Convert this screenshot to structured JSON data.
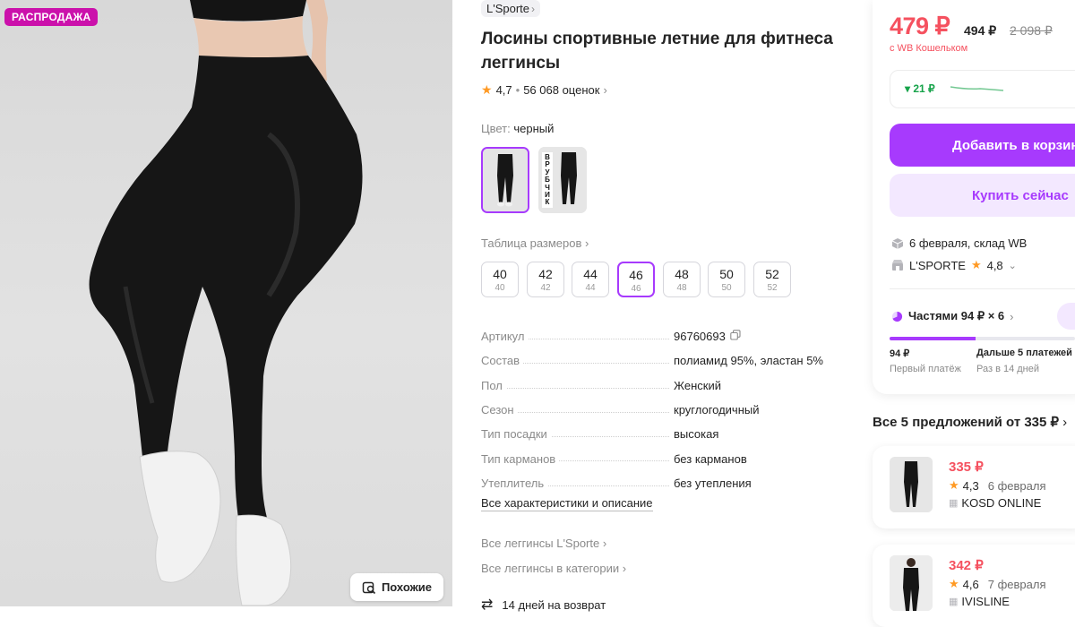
{
  "gallery": {
    "badge": "РАСПРОДАЖА",
    "similar_label": "Похожие"
  },
  "product": {
    "brand": "L'Sporte",
    "title": "Лосины спортивные летние для фитнеса леггинсы",
    "rating": "4,7",
    "reviews": "56 068 оценок",
    "color_label": "Цвет:",
    "color_value": "черный",
    "swatch2_text": "ВРУБЧИК",
    "sizes_link": "Таблица размеров",
    "sizes": [
      {
        "main": "40",
        "sub": "40"
      },
      {
        "main": "42",
        "sub": "42"
      },
      {
        "main": "44",
        "sub": "44"
      },
      {
        "main": "46",
        "sub": "46"
      },
      {
        "main": "48",
        "sub": "48"
      },
      {
        "main": "50",
        "sub": "50"
      },
      {
        "main": "52",
        "sub": "52"
      }
    ],
    "selected_size": "46",
    "specs": [
      {
        "k": "Артикул",
        "v": "96760693"
      },
      {
        "k": "Состав",
        "v": "полиамид 95%, эластан 5%"
      },
      {
        "k": "Пол",
        "v": "Женский"
      },
      {
        "k": "Сезон",
        "v": "круглогодичный"
      },
      {
        "k": "Тип посадки",
        "v": "высокая"
      },
      {
        "k": "Тип карманов",
        "v": "без карманов"
      },
      {
        "k": "Утеплитель",
        "v": "без утепления"
      }
    ],
    "all_specs": "Все характеристики и описание",
    "link_brand": "Все леггинсы L'Sporte",
    "link_category": "Все леггинсы в категории",
    "return_text": "14 дней на возврат"
  },
  "buy": {
    "price": "479 ₽",
    "price_old1": "494 ₽",
    "price_old2": "2 098 ₽",
    "wallet": "с WB Кошельком",
    "price_drop": "▾ 21 ₽",
    "add_to_cart": "Добавить в корзину",
    "buy_now": "Купить сейчас",
    "delivery": "6 февраля, склад WB",
    "seller": "L'SPORTE",
    "seller_rating": "4,8",
    "installments": "Частями 94 ₽ × 6",
    "installment_progress": 0.466,
    "pay1": "94 ₽",
    "pay1_sub": "Первый платёж",
    "pay2": "Дальше 5 платежей",
    "pay2_sub": "Раз в 14 дней"
  },
  "offers": {
    "title": "Все 5 предложений от 335 ₽",
    "items": [
      {
        "price": "335 ₽",
        "rating": "4,3",
        "date": "6 февраля",
        "seller": "KOSD ONLINE"
      },
      {
        "price": "342 ₽",
        "rating": "4,6",
        "date": "7 февраля",
        "seller": "IVISLINE"
      }
    ]
  },
  "colors": {
    "accent": "#a73afd",
    "price_red": "#f5515f",
    "badge": "#cb11ab",
    "star": "#ff9a24",
    "green": "#16a34a"
  }
}
